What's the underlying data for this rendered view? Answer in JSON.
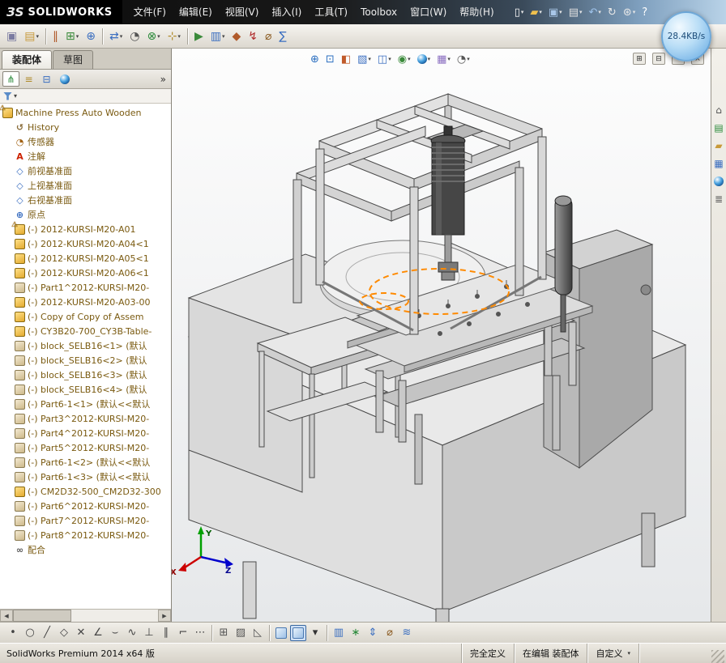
{
  "ui": {
    "caret": "▾",
    "warning": "⚠"
  },
  "titlebar": {
    "logo_glyph": "ЗS",
    "brand": "SOLIDWORKS",
    "menus": [
      "文件(F)",
      "编辑(E)",
      "视图(V)",
      "插入(I)",
      "工具(T)",
      "Toolbox",
      "窗口(W)",
      "帮助(H)"
    ],
    "quick_icons": [
      {
        "name": "new-document-button",
        "glyph": "▯",
        "color": "#f8f8f8",
        "caret": true
      },
      {
        "name": "open-document-button",
        "glyph": "▰",
        "color": "#eec04e",
        "caret": true
      },
      {
        "name": "save-button",
        "glyph": "▣",
        "color": "#a9c7e8",
        "caret": true
      },
      {
        "name": "print-button",
        "glyph": "▤",
        "color": "#e0e0e0",
        "caret": true
      },
      {
        "name": "undo-button",
        "glyph": "↶",
        "color": "#9fc4ec",
        "caret": true
      },
      {
        "name": "rebuild-button",
        "glyph": "↻",
        "color": "#e8e8e8"
      },
      {
        "name": "options-button",
        "glyph": "⊛",
        "color": "#e8e8e8",
        "caret": true
      },
      {
        "name": "help-button",
        "glyph": "?",
        "color": "#ffffff"
      }
    ]
  },
  "overlay_badge": {
    "text": "28.4KB/s"
  },
  "toolbar_main": {
    "icons": [
      {
        "name": "edit-component-button",
        "glyph": "▣",
        "color": "#7a7aa0"
      },
      {
        "name": "insert-components-button",
        "glyph": "▤",
        "color": "#c89a3a",
        "caret": true
      },
      {
        "sep": true
      },
      {
        "name": "mate-button",
        "glyph": "∥",
        "color": "#b05a2a"
      },
      {
        "name": "component-pattern-button",
        "glyph": "⊞",
        "color": "#3a8a3a",
        "caret": true
      },
      {
        "name": "smart-fasteners-button",
        "glyph": "⊕",
        "color": "#3a6ec0"
      },
      {
        "sep": true
      },
      {
        "name": "move-component-button",
        "glyph": "⇄",
        "color": "#3a6ec0",
        "caret": true
      },
      {
        "name": "show-hidden-components-button",
        "glyph": "◔",
        "color": "#555555"
      },
      {
        "name": "assembly-features-button",
        "glyph": "⊗",
        "color": "#2a8a3a",
        "caret": true
      },
      {
        "name": "reference-geometry-button",
        "glyph": "⊹",
        "color": "#b08a2a",
        "caret": true
      },
      {
        "sep": true
      },
      {
        "name": "motion-study-button",
        "glyph": "▶",
        "color": "#3a8a3a"
      },
      {
        "name": "bill-of-materials-button",
        "glyph": "▥",
        "color": "#3a6ec0",
        "caret": true
      },
      {
        "name": "exploded-view-button",
        "glyph": "◆",
        "color": "#b05a2a"
      },
      {
        "name": "interference-detection-button",
        "glyph": "↯",
        "color": "#b02a2a"
      },
      {
        "name": "measure-tool-button",
        "glyph": "⌀",
        "color": "#8a5a20"
      },
      {
        "name": "mass-properties-button",
        "glyph": "∑",
        "color": "#3a6ec0"
      }
    ]
  },
  "command_tabs": {
    "tabs": [
      {
        "label": "装配体"
      },
      {
        "label": "草图"
      }
    ]
  },
  "manager_bar": {
    "icons": [
      {
        "name": "featuremanager-tab-icon",
        "glyph": "⋔",
        "color": "#2a8a3a",
        "pressed": true
      },
      {
        "name": "propertymanager-tab-icon",
        "glyph": "≡",
        "color": "#b08a2a"
      },
      {
        "name": "configurationmanager-tab-icon",
        "glyph": "⊟",
        "color": "#3a6ec0"
      },
      {
        "name": "displaymanager-tab-icon",
        "ball": true
      }
    ],
    "chevron": "»"
  },
  "filter_bar": {
    "caret": "▾"
  },
  "scrollbar": {
    "left": "◀",
    "right": "▶"
  },
  "tree_icons": {
    "history": {
      "glyph": "↺",
      "color": "#8a6d3b"
    },
    "sensors": {
      "glyph": "◔",
      "color": "#a06010"
    },
    "annotations": {
      "glyph": "A",
      "color": "#cc2200"
    },
    "plane": {
      "glyph": "◇",
      "color": "#3a6ec0"
    },
    "origin": {
      "glyph": "⊕",
      "color": "#3a6ec0"
    },
    "mates": {
      "glyph": "∞",
      "color": "#555555"
    }
  },
  "tree": {
    "root": {
      "name": "tree-item-root",
      "icon": "assembly",
      "warning": true,
      "label": "Machine Press Auto Wooden"
    },
    "items": [
      {
        "name": "tree-item-history",
        "icon": "history",
        "label": "History"
      },
      {
        "name": "tree-item-sensors",
        "icon": "sensors",
        "label": "传感器"
      },
      {
        "name": "tree-item-annotations",
        "icon": "annotations",
        "label": "注解"
      },
      {
        "name": "tree-item-front-plane",
        "icon": "plane",
        "label": "前视基准面"
      },
      {
        "name": "tree-item-top-plane",
        "icon": "plane",
        "label": "上视基准面"
      },
      {
        "name": "tree-item-right-plane",
        "icon": "plane",
        "label": "右视基准面"
      },
      {
        "name": "tree-item-origin",
        "icon": "origin",
        "label": "原点"
      },
      {
        "name": "tree-item-a01",
        "icon": "assembly",
        "warning": true,
        "label": "(-) 2012-KURSI-M20-A01"
      },
      {
        "name": "tree-item-a04",
        "icon": "assembly",
        "label": "(-) 2012-KURSI-M20-A04<1"
      },
      {
        "name": "tree-item-a05",
        "icon": "assembly",
        "label": "(-) 2012-KURSI-M20-A05<1"
      },
      {
        "name": "tree-item-a06",
        "icon": "assembly",
        "label": "(-) 2012-KURSI-M20-A06<1"
      },
      {
        "name": "tree-item-part1",
        "icon": "part",
        "label": "(-) Part1^2012-KURSI-M20-"
      },
      {
        "name": "tree-item-a03",
        "icon": "assembly",
        "label": "(-) 2012-KURSI-M20-A03-00"
      },
      {
        "name": "tree-item-copy-assem",
        "icon": "assembly",
        "label": "(-) Copy of Copy of Assem"
      },
      {
        "name": "tree-item-cy3b20",
        "icon": "assembly",
        "label": "(-) CY3B20-700_CY3B-Table-"
      },
      {
        "name": "tree-item-block-selb16-1",
        "icon": "part",
        "label": "(-) block_SELB16<1> (默认"
      },
      {
        "name": "tree-item-block-selb16-2",
        "icon": "part",
        "label": "(-) block_SELB16<2> (默认"
      },
      {
        "name": "tree-item-block-selb16-3",
        "icon": "part",
        "label": "(-) block_SELB16<3> (默认"
      },
      {
        "name": "tree-item-block-selb16-4",
        "icon": "part",
        "label": "(-) block_SELB16<4> (默认"
      },
      {
        "name": "tree-item-part6-1-1",
        "icon": "part",
        "label": "(-) Part6-1<1> (默认<<默认"
      },
      {
        "name": "tree-item-part3",
        "icon": "part",
        "label": "(-) Part3^2012-KURSI-M20-"
      },
      {
        "name": "tree-item-part4",
        "icon": "part",
        "label": "(-) Part4^2012-KURSI-M20-"
      },
      {
        "name": "tree-item-part5",
        "icon": "part",
        "label": "(-) Part5^2012-KURSI-M20-"
      },
      {
        "name": "tree-item-part6-1-2",
        "icon": "part",
        "label": "(-) Part6-1<2> (默认<<默认"
      },
      {
        "name": "tree-item-part6-1-3",
        "icon": "part",
        "label": "(-) Part6-1<3> (默认<<默认"
      },
      {
        "name": "tree-item-cm2d32",
        "icon": "assembly",
        "label": "(-) CM2D32-500_CM2D32-300"
      },
      {
        "name": "tree-item-part6",
        "icon": "part",
        "label": "(-) Part6^2012-KURSI-M20-"
      },
      {
        "name": "tree-item-part7",
        "icon": "part",
        "label": "(-) Part7^2012-KURSI-M20-"
      },
      {
        "name": "tree-item-part8",
        "icon": "part",
        "label": "(-) Part8^2012-KURSI-M20-"
      },
      {
        "name": "tree-item-mates",
        "icon": "mates",
        "label": "配合"
      }
    ]
  },
  "headsup": {
    "icons": [
      {
        "name": "zoom-fit-button",
        "glyph": "⊕",
        "color": "#2a6ec0"
      },
      {
        "name": "zoom-area-button",
        "glyph": "⊡",
        "color": "#2a6ec0"
      },
      {
        "name": "section-view-button",
        "glyph": "◧",
        "color": "#c05a2a"
      },
      {
        "name": "view-orientation-button",
        "glyph": "▧",
        "color": "#3a6ec0",
        "caret": true
      },
      {
        "name": "display-style-button",
        "glyph": "◫",
        "color": "#3a6ec0",
        "caret": true
      },
      {
        "name": "hide-show-items-button",
        "glyph": "◉",
        "color": "#3a8a3a",
        "caret": true
      },
      {
        "name": "edit-appearance-button",
        "ball": true,
        "caret": true
      },
      {
        "name": "apply-scene-button",
        "glyph": "▦",
        "color": "#8a6ec0",
        "caret": true
      },
      {
        "name": "view-settings-button",
        "glyph": "◔",
        "color": "#555555",
        "caret": true
      }
    ]
  },
  "doc_controls": {
    "icons": [
      {
        "name": "doc-tile-icon",
        "glyph": "⊞",
        "color": "#333333"
      },
      {
        "name": "doc-restore-icon",
        "glyph": "⊟",
        "color": "#333333"
      },
      {
        "name": "doc-minimize-icon",
        "glyph": "‒",
        "color": "#333333"
      },
      {
        "name": "doc-close-icon",
        "glyph": "×",
        "color": "#333333"
      }
    ]
  },
  "taskpane": {
    "icons": [
      {
        "name": "task-pane-home-icon",
        "glyph": "⌂",
        "color": "#555555"
      },
      {
        "name": "design-library-icon",
        "glyph": "▤",
        "color": "#2a8a3a"
      },
      {
        "name": "file-explorer-icon",
        "glyph": "▰",
        "color": "#c89a3a"
      },
      {
        "name": "view-palette-icon",
        "glyph": "▦",
        "color": "#3a6ec0"
      },
      {
        "name": "appearances-icon",
        "ball": true
      },
      {
        "name": "custom-properties-icon",
        "glyph": "≣",
        "color": "#555555"
      }
    ]
  },
  "bottom_toolbar": {
    "icons": [
      {
        "name": "sketch-point-button",
        "glyph": "•",
        "color": "#444444"
      },
      {
        "name": "sketch-circle-button",
        "glyph": "○",
        "color": "#444444"
      },
      {
        "name": "sketch-line-button",
        "glyph": "╱",
        "color": "#444444"
      },
      {
        "name": "sketch-polygon-button",
        "glyph": "◇",
        "color": "#444444"
      },
      {
        "name": "sketch-cross-button",
        "glyph": "✕",
        "color": "#444444"
      },
      {
        "name": "sketch-angle-button",
        "glyph": "∠",
        "color": "#444444"
      },
      {
        "name": "sketch-arc-button",
        "glyph": "⌣",
        "color": "#444444"
      },
      {
        "name": "sketch-spline-button",
        "glyph": "∿",
        "color": "#444444"
      },
      {
        "name": "sketch-perpendicular-button",
        "glyph": "⊥",
        "color": "#444444"
      },
      {
        "name": "sketch-offset-button",
        "glyph": "∥",
        "color": "#444444"
      },
      {
        "name": "sketch-corner-button",
        "glyph": "⌐",
        "color": "#444444"
      },
      {
        "name": "sketch-pattern-button",
        "glyph": "⋯",
        "color": "#444444"
      },
      {
        "sep": true
      },
      {
        "name": "grid-snap-button",
        "glyph": "⊞",
        "color": "#555555"
      },
      {
        "name": "hatch-button",
        "glyph": "▨",
        "color": "#555555"
      },
      {
        "name": "fillet-button",
        "glyph": "◺",
        "color": "#555555"
      },
      {
        "sep": true
      },
      {
        "name": "view-normal-button",
        "cube": true
      },
      {
        "name": "view-isometric-button",
        "cube": true,
        "pressed": true
      },
      {
        "name": "view-orientation-caret",
        "glyph": "▾",
        "color": "#333333"
      },
      {
        "sep": true
      },
      {
        "name": "section-tool-button",
        "glyph": "▥",
        "color": "#3a6ec0"
      },
      {
        "name": "assembly-xpert-button",
        "glyph": "∗",
        "color": "#2a8a3a"
      },
      {
        "name": "move-component-button",
        "glyph": "⇕",
        "color": "#3a6ec0"
      },
      {
        "name": "measure-button",
        "glyph": "⌀",
        "color": "#8a5a20"
      },
      {
        "name": "mate-button",
        "glyph": "≋",
        "color": "#3a6ec0"
      }
    ]
  },
  "viewport": {
    "triad": {
      "x": "X",
      "y": "Y",
      "z": "Z"
    },
    "highlight_color": "#ff8a00"
  },
  "statusbar": {
    "product": "SolidWorks Premium 2014 x64 版",
    "defined": "完全定义",
    "editing": "在编辑 装配体",
    "custom": "自定义"
  }
}
